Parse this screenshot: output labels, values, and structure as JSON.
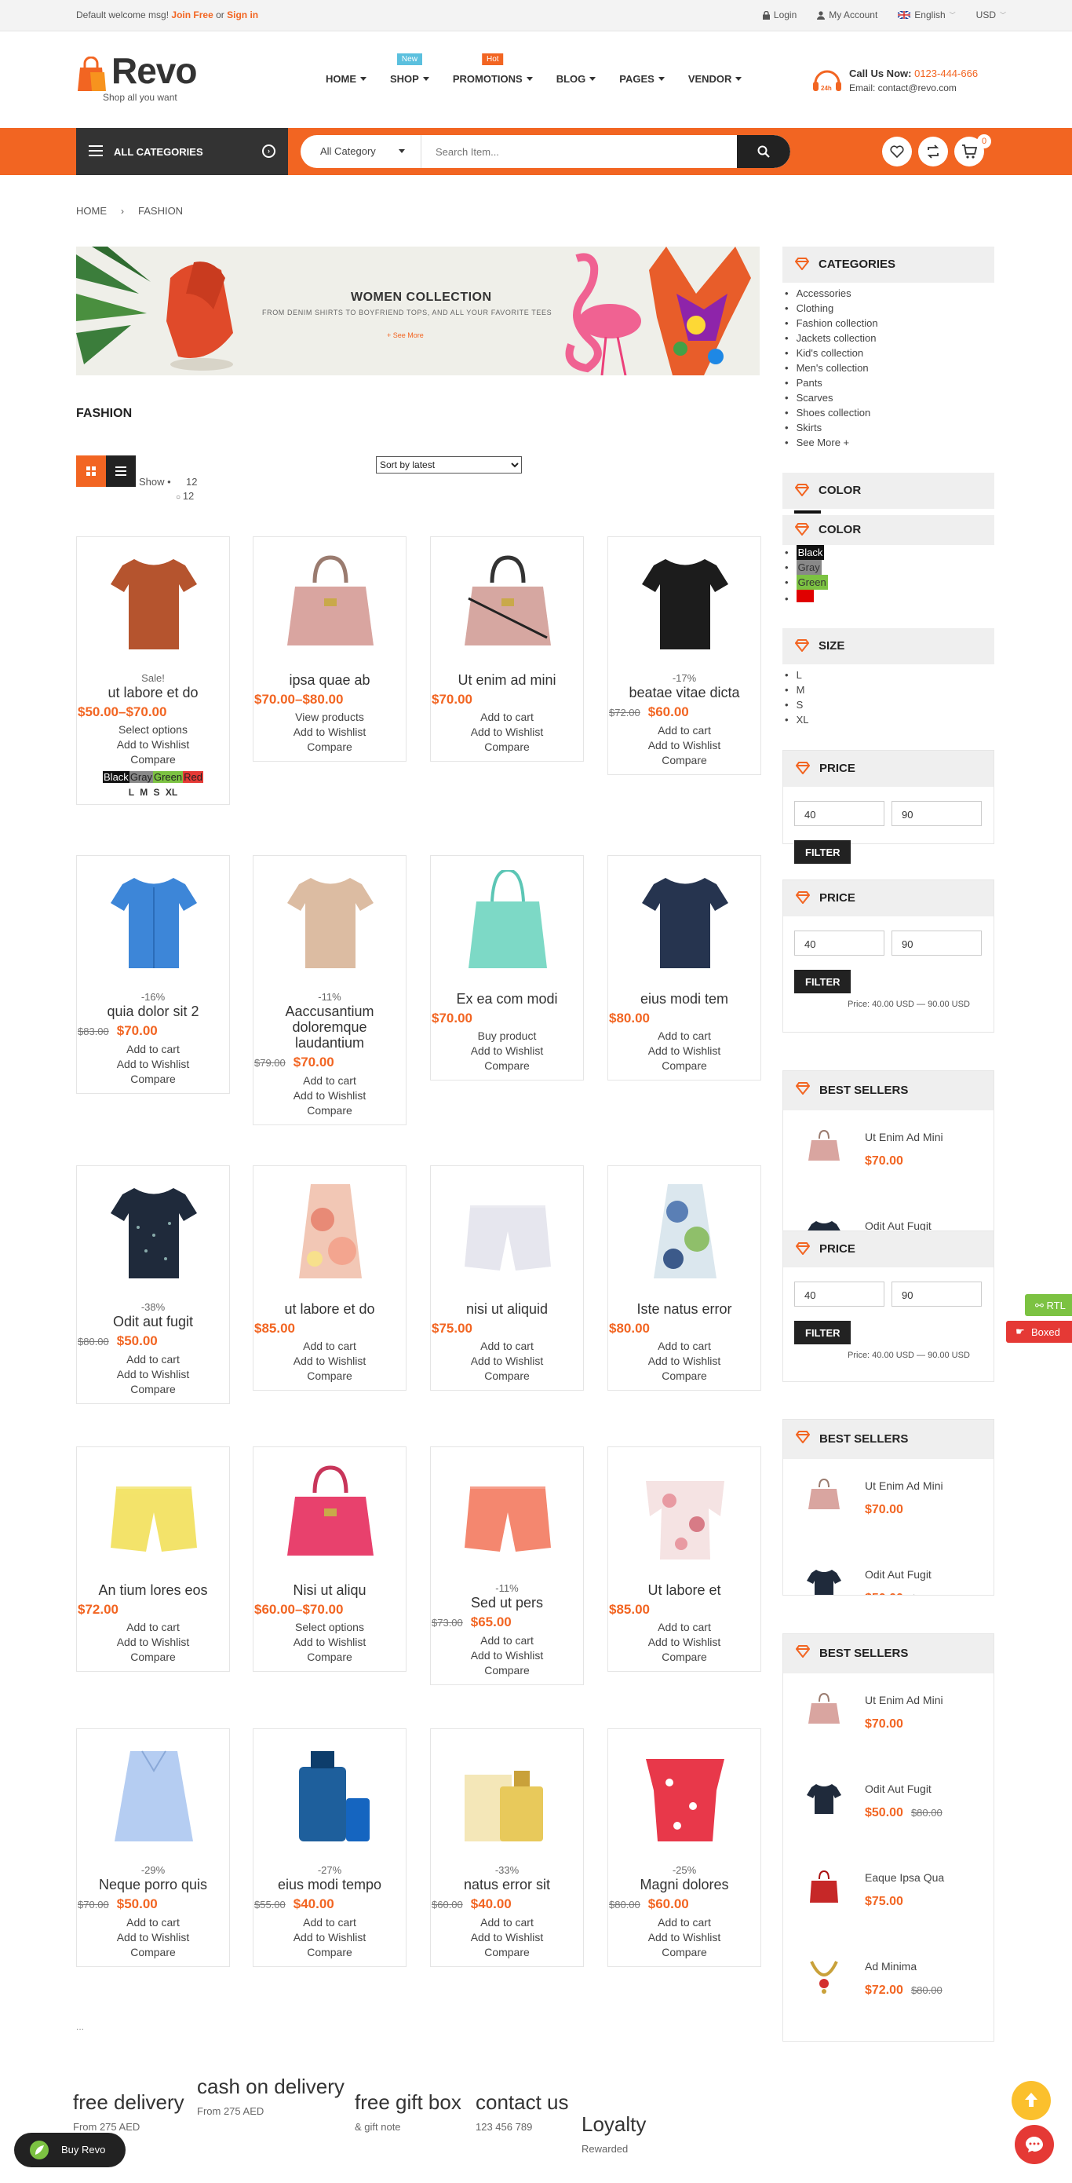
{
  "topbar": {
    "welcome": "Default welcome msg!",
    "join": "Join Free",
    "or": "or",
    "signin": "Sign in",
    "login": "Login",
    "account": "My Account",
    "language": "English",
    "currency": "USD"
  },
  "logo": {
    "name": "Revo",
    "tagline": "Shop all you want"
  },
  "nav": [
    {
      "label": "HOME",
      "badge": ""
    },
    {
      "label": "SHOP",
      "badge": "New",
      "badge_color": "#5bc0de"
    },
    {
      "label": "PROMOTIONS",
      "badge": "Hot",
      "badge_color": "#f26522"
    },
    {
      "label": "BLOG",
      "badge": ""
    },
    {
      "label": "PAGES",
      "badge": ""
    },
    {
      "label": "VENDOR",
      "badge": ""
    }
  ],
  "call": {
    "label": "Call Us Now:",
    "phone": "0123-444-666",
    "email": "Email: contact@revo.com"
  },
  "search": {
    "all_categories": "ALL CATEGORIES",
    "category": "All Category",
    "placeholder": "Search Item...",
    "cart_count": "0"
  },
  "breadcrumb": {
    "home": "HOME",
    "current": "FASHION"
  },
  "banner": {
    "title": "WOMEN COLLECTION",
    "subtitle": "FROM DENIM SHIRTS TO BOYFRIEND TOPS, AND ALL YOUR FAVORITE TEES",
    "link": "+ See More"
  },
  "page_title": "FASHION",
  "toolbar": {
    "show": "Show",
    "show_value": "12",
    "show_option": "12",
    "sort": "Sort by latest"
  },
  "products": [
    {
      "name": "ut labore et do",
      "sale": "Sale!",
      "old": "",
      "price": "$50.00–$70.00",
      "actions": [
        "Select options",
        "Add to Wishlist",
        "Compare"
      ],
      "swatches": [
        "Black",
        "Gray",
        "Green",
        "Red"
      ],
      "sizes": "L M S XL",
      "img": "top-orange"
    },
    {
      "name": "ipsa quae ab",
      "sale": "",
      "old": "",
      "price": "$70.00–$80.00",
      "actions": [
        "View products",
        "Add to Wishlist",
        "Compare"
      ],
      "img": "bag-pink"
    },
    {
      "name": "Ut enim ad mini",
      "sale": "",
      "old": "",
      "price": "$70.00",
      "actions": [
        "Add to cart",
        "Add to Wishlist",
        "Compare"
      ],
      "img": "bag-pink2"
    },
    {
      "name": "beatae vitae dicta",
      "sale": "-17%",
      "old": "$72.00",
      "price": "$60.00",
      "actions": [
        "Add to cart",
        "Add to Wishlist",
        "Compare"
      ],
      "img": "tee-black"
    },
    {
      "name": "quia dolor sit 2",
      "sale": "-16%",
      "old": "$83.00",
      "price": "$70.00",
      "actions": [
        "Add to cart",
        "Add to Wishlist",
        "Compare"
      ],
      "img": "shirt-blue"
    },
    {
      "name": "Aaccusantium doloremque laudantium",
      "sale": "-11%",
      "old": "$79.00",
      "price": "$70.00",
      "actions": [
        "Add to cart",
        "Add to Wishlist",
        "Compare"
      ],
      "img": "sweater-beige"
    },
    {
      "name": "Ex ea com modi",
      "sale": "",
      "old": "",
      "price": "$70.00",
      "actions": [
        "Buy product",
        "Add to Wishlist",
        "Compare"
      ],
      "img": "tote-mint"
    },
    {
      "name": "eius modi tem",
      "sale": "",
      "old": "",
      "price": "$80.00",
      "actions": [
        "Add to cart",
        "Add to Wishlist",
        "Compare"
      ],
      "img": "tee-navy"
    },
    {
      "name": "Odit aut fugit",
      "sale": "-38%",
      "old": "$80.00",
      "price": "$50.00",
      "actions": [
        "Add to cart",
        "Add to Wishlist",
        "Compare"
      ],
      "img": "tee-dots"
    },
    {
      "name": "ut labore et do",
      "sale": "",
      "old": "",
      "price": "$85.00",
      "actions": [
        "Add to cart",
        "Add to Wishlist",
        "Compare"
      ],
      "img": "top-floral"
    },
    {
      "name": "nisi ut aliquid",
      "sale": "",
      "old": "",
      "price": "$75.00",
      "actions": [
        "Add to cart",
        "Add to Wishlist",
        "Compare"
      ],
      "img": "shorts-white"
    },
    {
      "name": "Iste natus error",
      "sale": "",
      "old": "",
      "price": "$80.00",
      "actions": [
        "Add to cart",
        "Add to Wishlist",
        "Compare"
      ],
      "img": "tank-floral"
    },
    {
      "name": "An tium lores eos",
      "sale": "",
      "old": "",
      "price": "$72.00",
      "actions": [
        "Add to cart",
        "Add to Wishlist",
        "Compare"
      ],
      "img": "shorts-yellow"
    },
    {
      "name": "Nisi ut aliqu",
      "sale": "",
      "old": "",
      "price": "$60.00–$70.00",
      "actions": [
        "Select options",
        "Add to Wishlist",
        "Compare"
      ],
      "img": "bag-magenta"
    },
    {
      "name": "Sed ut pers",
      "sale": "-11%",
      "old": "$73.00",
      "price": "$65.00",
      "actions": [
        "Add to cart",
        "Add to Wishlist",
        "Compare"
      ],
      "img": "shorts-coral"
    },
    {
      "name": "Ut labore et",
      "sale": "",
      "old": "",
      "price": "$85.00",
      "actions": [
        "Add to cart",
        "Add to Wishlist",
        "Compare"
      ],
      "img": "blouse-floral"
    },
    {
      "name": "Neque porro quis",
      "sale": "-29%",
      "old": "$70.00",
      "price": "$50.00",
      "actions": [
        "Add to cart",
        "Add to Wishlist",
        "Compare"
      ],
      "img": "top-lightblue"
    },
    {
      "name": "eius modi tempo",
      "sale": "-27%",
      "old": "$55.00",
      "price": "$40.00",
      "actions": [
        "Add to cart",
        "Add to Wishlist",
        "Compare"
      ],
      "img": "perfume-blue"
    },
    {
      "name": "natus error sit",
      "sale": "-33%",
      "old": "$60.00",
      "price": "$40.00",
      "actions": [
        "Add to cart",
        "Add to Wishlist",
        "Compare"
      ],
      "img": "perfume-gold"
    },
    {
      "name": "Magni dolores",
      "sale": "-25%",
      "old": "$80.00",
      "price": "$60.00",
      "actions": [
        "Add to cart",
        "Add to Wishlist",
        "Compare"
      ],
      "img": "top-red"
    }
  ],
  "sidebar": {
    "categories_title": "CATEGORIES",
    "categories": [
      "Accessories",
      "Clothing",
      "Fashion collection",
      "Jackets collection",
      "Kid's collection",
      "Men's collection",
      "Pants",
      "Scarves",
      "Shoes collection",
      "Skirts",
      "See More +"
    ],
    "color_title": "COLOR",
    "colors": [
      "Black",
      "Gray",
      "Green",
      ""
    ],
    "size_title": "SIZE",
    "sizes": [
      "L",
      "M",
      "S",
      "XL"
    ],
    "price_title": "PRICE",
    "price_min": "40",
    "price_max": "90",
    "filter": "FILTER",
    "price_range": "Price: 40.00 USD — 90.00 USD",
    "bestsellers_title": "BEST SELLERS",
    "bestsellers": [
      {
        "name": "Ut Enim Ad Mini",
        "price": "$70.00",
        "old": ""
      },
      {
        "name": "Odit Aut Fugit",
        "price": "$50.00",
        "old": "$80.00"
      },
      {
        "name": "Eaque Ipsa Qua",
        "price": "$75.00",
        "old": ""
      },
      {
        "name": "Ad Minima",
        "price": "$72.00",
        "old": "$80.00"
      }
    ]
  },
  "sidetabs": {
    "rtl": "RTL",
    "boxed": "Boxed"
  },
  "pagination": "...",
  "footer": [
    {
      "title": "free delivery",
      "sub": "From 275 AED"
    },
    {
      "title": "cash on delivery",
      "sub": "From 275 AED"
    },
    {
      "title": "free gift box",
      "sub": "& gift note"
    },
    {
      "title": "contact us",
      "sub": "123 456 789"
    },
    {
      "title": "Loyalty",
      "sub": "Rewarded"
    }
  ],
  "buy_revo": "Buy Revo",
  "colors_theme": {
    "accent": "#f26522",
    "dark": "#222222"
  }
}
